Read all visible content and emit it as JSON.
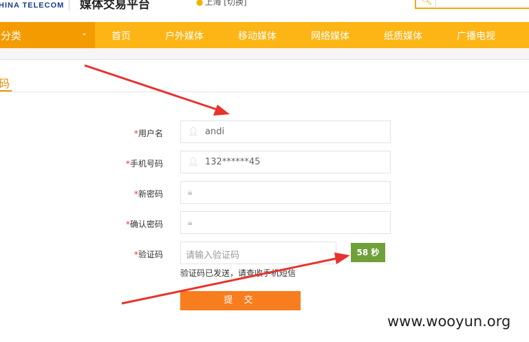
{
  "header": {
    "brand_text": "HINA TELECOM",
    "site_title": "媒体交易平台",
    "location": "上海 [切换]"
  },
  "nav": {
    "category_label": "分类",
    "items": [
      "首页",
      "户外媒体",
      "移动媒体",
      "网络媒体",
      "纸质媒体",
      "广播电视"
    ]
  },
  "page_tab": {
    "label": "码"
  },
  "form": {
    "required_mark": "*",
    "username": {
      "label": "用户名",
      "value": "andi"
    },
    "phone": {
      "label": "手机号码",
      "value": "132******45"
    },
    "new_password": {
      "label": "新密码",
      "value": ""
    },
    "confirm_password": {
      "label": "确认密码",
      "value": ""
    },
    "captcha": {
      "label": "验证码",
      "placeholder": "请输入验证码",
      "countdown": "58 秒",
      "hint": "验证码已发送，请查收手机短信"
    },
    "submit_label": "提 交"
  },
  "watermark": "www.wooyun.org",
  "colors": {
    "nav": "#fdb515",
    "nav_category": "#f49b00",
    "submit": "#f77d1e",
    "countdown": "#6fa03a",
    "arrow": "#e8322c"
  }
}
